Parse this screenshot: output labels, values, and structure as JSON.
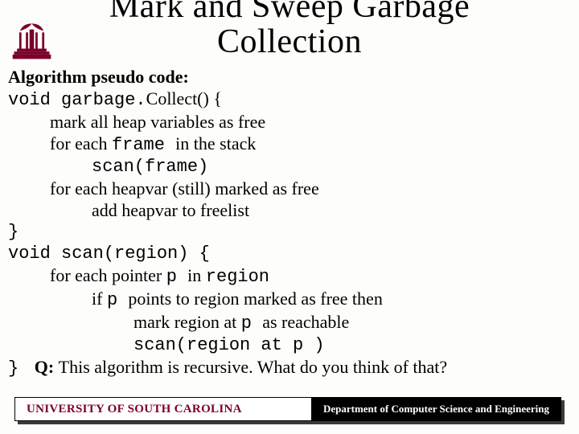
{
  "title_line1": "Mark and Sweep Garbage",
  "title_line2": "Collection",
  "subhead": "Algorithm pseudo code:",
  "code": {
    "l1a": "void garbage.",
    "l1b": "Collect() {",
    "l2": "mark all heap variables as free",
    "l3a": "for each ",
    "l3b": "frame ",
    "l3c": "in the stack",
    "l4": "scan(frame)",
    "l5": "for each heapvar (still) marked as free",
    "l6": "add heapvar to freelist",
    "l7": "}",
    "l8": "void scan(region) {",
    "l9a": "for each pointer ",
    "l9b": "p ",
    "l9c": "in ",
    "l9d": "region",
    "l10a": "if ",
    "l10b": "p ",
    "l10c": " points to region marked as free then",
    "l11a": "mark region at ",
    "l11b": "p ",
    "l11c": "as reachable",
    "l12": "scan(region at p )",
    "l13": "}"
  },
  "question_label": "Q: ",
  "question_text": "This algorithm is recursive. What do you think of that?",
  "footer_left": "UNIVERSITY OF SOUTH CAROLINA",
  "footer_right": "Department of Computer Science and Engineering",
  "colors": {
    "garnet": "#7a002a"
  }
}
